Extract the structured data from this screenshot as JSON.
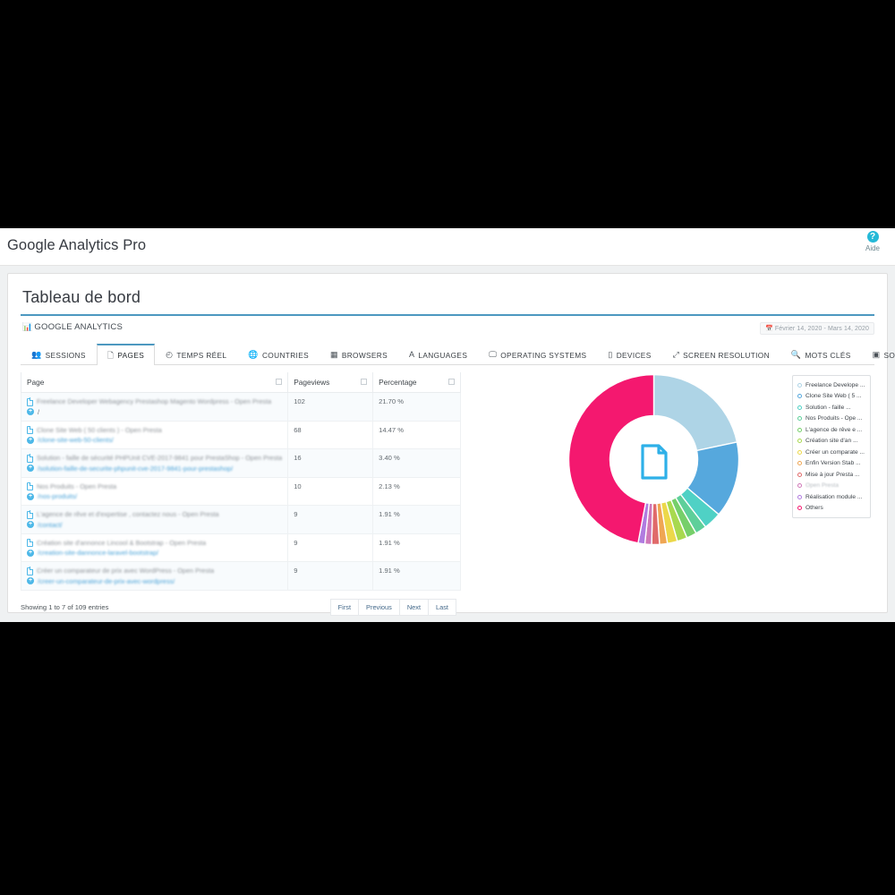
{
  "appbar": {
    "title": "Google Analytics Pro",
    "help_label": "Aide",
    "help_icon": "question-mark-icon"
  },
  "panel": {
    "title": "Tableau de bord",
    "section_kicker": "GOOGLE ANALYTICS",
    "kicker_icon": "bar-chart-icon",
    "date_range": "Février 14, 2020 - Mars 14, 2020",
    "date_range_icon": "calendar-icon"
  },
  "tabs": [
    {
      "label": "SESSIONS",
      "icon": "users-icon",
      "active": false
    },
    {
      "label": "PAGES",
      "icon": "file-icon",
      "active": true
    },
    {
      "label": "TEMPS RÉEL",
      "icon": "clock-icon",
      "active": false
    },
    {
      "label": "COUNTRIES",
      "icon": "globe-icon",
      "active": false
    },
    {
      "label": "BROWSERS",
      "icon": "window-icon",
      "active": false
    },
    {
      "label": "LANGUAGES",
      "icon": "letter-a-icon",
      "active": false
    },
    {
      "label": "OPERATING SYSTEMS",
      "icon": "desktop-icon",
      "active": false
    },
    {
      "label": "DEVICES",
      "icon": "mobile-icon",
      "active": false
    },
    {
      "label": "SCREEN RESOLUTION",
      "icon": "expand-icon",
      "active": false
    },
    {
      "label": "MOTS CLÉS",
      "icon": "search-icon",
      "active": false
    },
    {
      "label": "SOURCE",
      "icon": "share-icon",
      "active": false
    }
  ],
  "toolbar_icons": [
    {
      "name": "search-zoom-icon",
      "glyph": "⌕"
    },
    {
      "name": "gear-icon",
      "glyph": "⚙"
    }
  ],
  "table": {
    "columns": [
      "Page",
      "Pageviews",
      "Percentage"
    ],
    "rows": [
      {
        "title": "Freelance Developer Webagency Prestashop Magento Wordpress - Open Presta",
        "url": "/",
        "url_blurred": false,
        "pageviews": "102",
        "percentage": "21.70 %"
      },
      {
        "title": "Clone Site Web ( 50 clients ) - Open Presta",
        "url": "/clone-site-web-50-clients/",
        "url_blurred": true,
        "pageviews": "68",
        "percentage": "14.47 %"
      },
      {
        "title": "Solution - faille de sécurité PHPUnit CVE-2017-9841 pour PrestaShop - Open Presta",
        "url": "/solution-faille-de-securite-phpunit-cve-2017-9841-pour-prestashop/",
        "url_blurred": true,
        "pageviews": "16",
        "percentage": "3.40 %"
      },
      {
        "title": "Nos Produits - Open Presta",
        "url": "/nos-produits/",
        "url_blurred": true,
        "pageviews": "10",
        "percentage": "2.13 %"
      },
      {
        "title": "L'agence de rêve et d'expertise , contactez nous - Open Presta",
        "url": "/contact/",
        "url_blurred": true,
        "pageviews": "9",
        "percentage": "1.91 %"
      },
      {
        "title": "Création site d'annonce Lincool & Bootstrap - Open Presta",
        "url": "/creation-site-dannonce-laravel-bootstrap/",
        "url_blurred": true,
        "pageviews": "9",
        "percentage": "1.91 %"
      },
      {
        "title": "Créer un comparateur de prix avec WordPress - Open Presta",
        "url": "/creer-un-comparateur-de-prix-avec-wordpress/",
        "url_blurred": true,
        "pageviews": "9",
        "percentage": "1.91 %"
      }
    ],
    "showing_info": "Showing 1 to 7 of 109 entries",
    "pager": [
      "First",
      "Previous",
      "Next",
      "Last"
    ]
  },
  "chart_data": {
    "type": "pie",
    "title": "",
    "variant": "donut",
    "center_icon": "file-page-icon",
    "legend_position": "right",
    "labels": [
      "Freelance Develope ...",
      "Clone Site Web ( 5 ...",
      "Solution - faille ...",
      "Nos Produits - Ope ...",
      "L'agence de rêve e ...",
      "Création site d'an ...",
      "Créer un comparate ...",
      "Enfin Version Stab ...",
      "Mise à jour Presta ...",
      "Open Presta",
      "Réalisation module ...",
      "Others"
    ],
    "values": [
      21.7,
      14.47,
      3.4,
      2.13,
      1.91,
      1.91,
      1.91,
      1.49,
      1.49,
      1.28,
      1.28,
      47.03
    ],
    "colors": [
      "#aed4e6",
      "#56a8dd",
      "#4fd1c5",
      "#5ecf9a",
      "#76cf6a",
      "#a8d94f",
      "#ecd84a",
      "#efa653",
      "#e06a6a",
      "#cf78b8",
      "#b07be0",
      "#f4186f"
    ],
    "dimmed_legend_index": 9
  }
}
